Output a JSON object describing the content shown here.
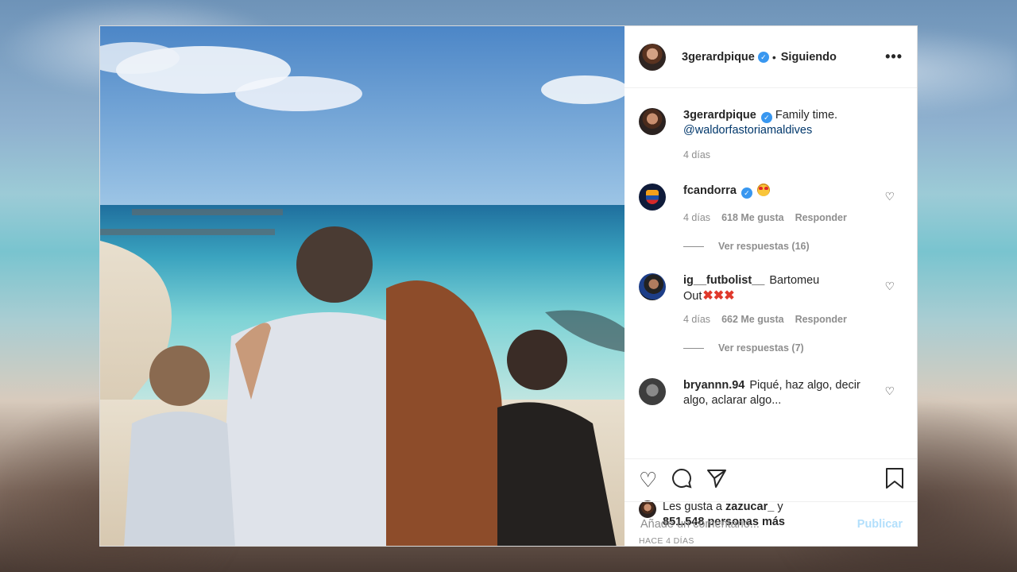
{
  "header": {
    "username": "3gerardpique",
    "separator": "•",
    "follow_status": "Siguiendo",
    "more_icon": "more-options-icon"
  },
  "caption": {
    "username": "3gerardpique",
    "text": "Family time.",
    "mention": "@waldorfastoriamaldives",
    "time": "4 días"
  },
  "comments": [
    {
      "username": "fcandorra",
      "verified": true,
      "text": "",
      "emoji": "star-struck-emoji",
      "time": "4 días",
      "likes": "618 Me gusta",
      "reply": "Responder",
      "view_replies": "Ver respuestas (16)"
    },
    {
      "username": "ig__futbolist__",
      "verified": false,
      "text": "Bartomeu",
      "text2": "Out",
      "emoji": "cross-mark-emoji x3",
      "time": "4 días",
      "likes": "662 Me gusta",
      "reply": "Responder",
      "view_replies": "Ver respuestas (7)"
    },
    {
      "username": "bryannn.94",
      "verified": false,
      "text": "Piqué, haz algo, decir",
      "text2": "algo, aclarar algo..."
    }
  ],
  "actions": {
    "like_icon": "heart-icon",
    "comment_icon": "comment-icon",
    "share_icon": "paper-plane-icon",
    "save_icon": "bookmark-icon"
  },
  "likes": {
    "prefix": "Les gusta a",
    "user": "zazucar_",
    "conj": "y",
    "count": "851.548 personas más"
  },
  "timestamp": "HACE 4 DÍAS",
  "add_comment": {
    "placeholder": "Añade un comentario...",
    "publish_label": "Publicar"
  },
  "colors": {
    "link": "#00376b",
    "verified": "#3897f0",
    "publish_disabled": "#b2dffc",
    "muted": "#8e8e8e"
  }
}
